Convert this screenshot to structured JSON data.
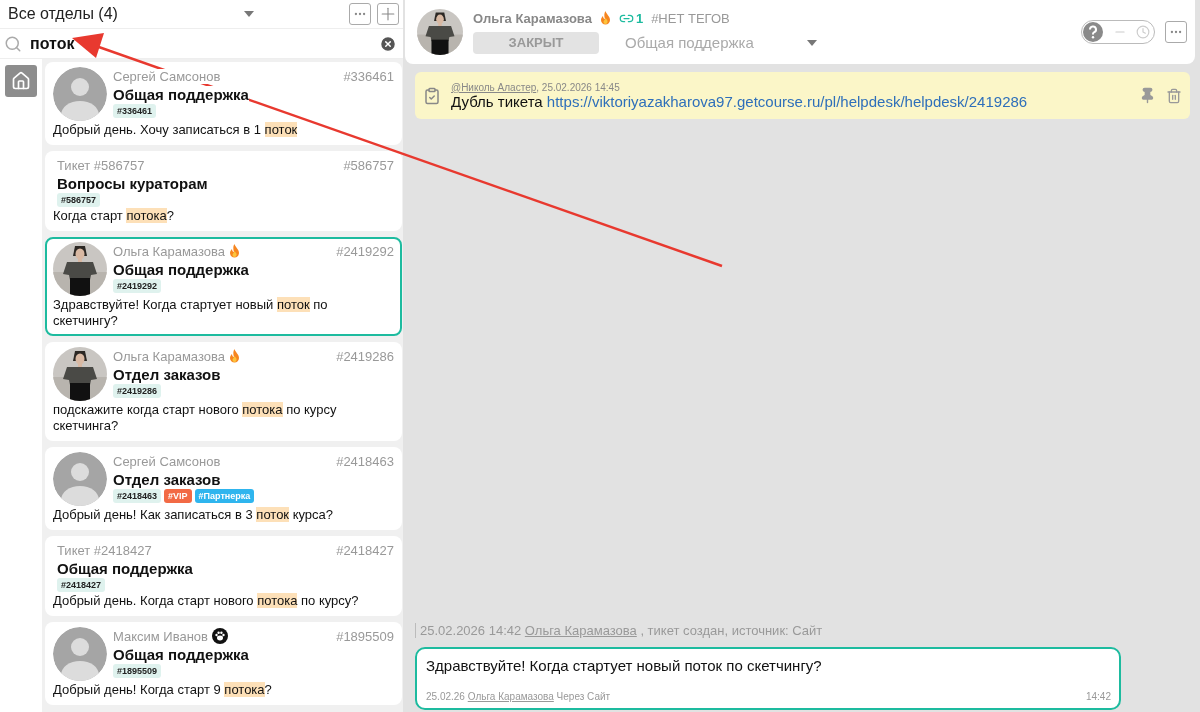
{
  "sidebar": {
    "department_filter": "Все отделы (4)",
    "search": {
      "value": "поток"
    },
    "tickets": [
      {
        "avatar": {
          "kind": "placeholder"
        },
        "author": "Сергей Самсонов",
        "number": "#336461",
        "department": "Общая поддержка",
        "tags": [
          {
            "label": "#336461",
            "color": "#dff2ee"
          }
        ],
        "message": {
          "before": "Добрый день. Хочу записаться в 1 ",
          "match": "поток"
        },
        "selected": false
      },
      {
        "avatar": {
          "kind": "none"
        },
        "author": "Тикет #586757",
        "number": "#586757",
        "department": "Вопросы кураторам",
        "tags": [
          {
            "label": "#586757",
            "color": "#dff2ee"
          }
        ],
        "message": {
          "before": "Когда старт ",
          "match": "потока",
          "after": "?"
        },
        "selected": false
      },
      {
        "author": "Ольга Карамазова",
        "badge": {
          "kind": "fire"
        },
        "number": "#2419292",
        "department": "Общая поддержка",
        "tags": [
          {
            "label": "#2419292",
            "color": "#dff2ee"
          }
        ],
        "message": {
          "before": "Здравствуйте! Когда стартует новый ",
          "match": "поток",
          "after": " по скетчингу?"
        },
        "selected": true
      },
      {
        "author": "Ольга Карамазова",
        "badge": {
          "kind": "fire"
        },
        "number": "#2419286",
        "department": "Отдел заказов",
        "tags": [
          {
            "label": "#2419286",
            "color": "#dff2ee"
          }
        ],
        "message": {
          "before": "подскажите когда старт нового ",
          "match": "потока",
          "after": " по курсу скетчинга?"
        },
        "selected": false
      },
      {
        "avatar": {
          "kind": "placeholder"
        },
        "author": "Сергей Самсонов",
        "number": "#2418463",
        "department": "Отдел заказов",
        "tags": [
          {
            "label": "#2418463",
            "color": "#dff2ee"
          },
          {
            "label": "#VIP",
            "color": "#f26a45"
          },
          {
            "label": "#Партнерка",
            "color": "#2fb5ee"
          }
        ],
        "message": {
          "before": "Добрый день! Как записаться в 3 ",
          "match": "поток",
          "after": " курса?"
        },
        "selected": false
      },
      {
        "avatar": {
          "kind": "none"
        },
        "author": "Тикет #2418427",
        "number": "#2418427",
        "department": "Общая поддержка",
        "tags": [
          {
            "label": "#2418427",
            "color": "#dff2ee"
          }
        ],
        "message": {
          "before": "Добрый день. Когда старт нового ",
          "match": "потока",
          "after": " по курсу?"
        },
        "selected": false
      },
      {
        "avatar": {
          "kind": "placeholder"
        },
        "author": "Максим Иванов",
        "badge": {
          "kind": "paw"
        },
        "number": "#1895509",
        "department": "Общая поддержка",
        "tags": [
          {
            "label": "#1895509",
            "color": "#dff2ee"
          }
        ],
        "message": {
          "before": "Добрый день! Когда старт 9 ",
          "match": "потока",
          "after": "?"
        },
        "selected": false
      }
    ]
  },
  "ticket_header": {
    "name": "Ольга Карамазова",
    "badge": {
      "kind": "fire"
    },
    "links_count": "1",
    "tags_text": "#НЕТ ТЕГОВ",
    "status": "ЗАКРЫТ",
    "department": "Общая поддержка"
  },
  "note": {
    "author": "@Николь Аластер",
    "date": ", 25.02.2026 14:45",
    "text": "Дубль тикета ",
    "link": "https://viktoriyazakharova97.getcourse.ru/pl/helpdesk/helpdesk/2419286"
  },
  "timeline": {
    "date": "25.02.2026 14:42 ",
    "author": "Ольга Карамазова",
    "text": " , тикет создан, источник: Сайт"
  },
  "message": {
    "text": "Здравствуйте! Когда стартует новый поток по скетчингу?",
    "date": "25.02.26 ",
    "author": "Ольга Карамазова",
    "source": " Через Сайт",
    "time": "14:42"
  },
  "annotation": {
    "kind": "arrow"
  }
}
